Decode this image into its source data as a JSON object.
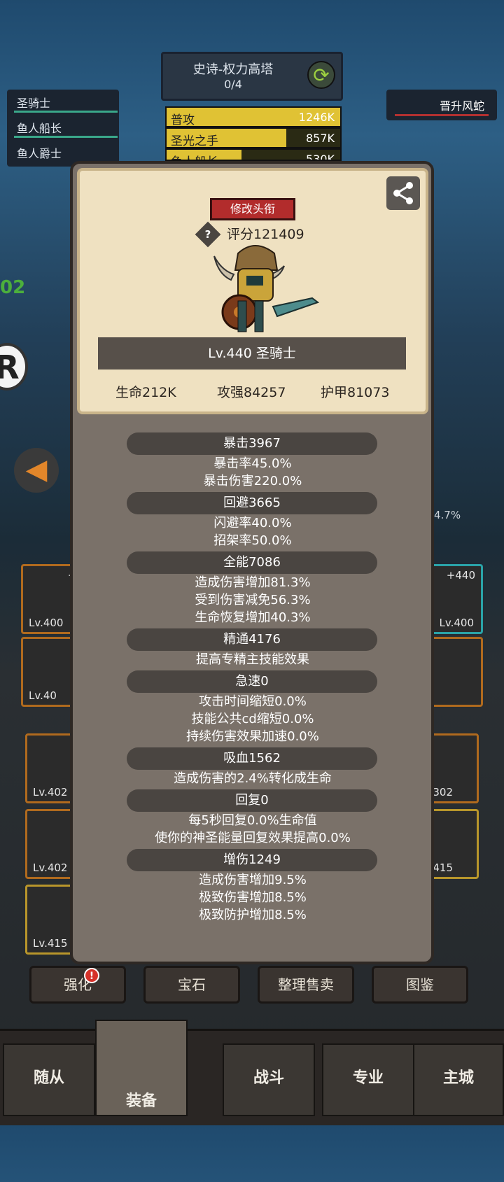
{
  "tower": {
    "title": "史诗-权力高塔",
    "progress": "0/4"
  },
  "left_list": [
    "圣骑士",
    "鱼人船长",
    "鱼人爵士"
  ],
  "right_tag": "晋升风蛇",
  "damage_rows": [
    {
      "name": "普攻",
      "value": "1246K",
      "fill": 1.0
    },
    {
      "name": "圣光之手",
      "value": "857K",
      "fill": 0.69
    },
    {
      "name": "鱼人船长",
      "value": "530K",
      "fill": 0.43
    }
  ],
  "bg_misc": {
    "big_letter": "R",
    "green_number": "02",
    "pct": "4.7%"
  },
  "slots": {
    "top_left_plus": "+4",
    "top_left_lvl": "Lv.400",
    "mid_left_lvl": "Lv.40",
    "top_right_plus": "+440",
    "top_right_lvl": "Lv.400",
    "lower_left_1": "Lv.402",
    "lower_left_2": "Lv.402",
    "lower_left_3": "Lv.415",
    "lower_right_1": "302",
    "lower_right_2": "415"
  },
  "modal": {
    "change_title_label": "修改头衔",
    "score_label": "评分121409",
    "hero_name": "Lv.440 圣骑士",
    "base_stats": {
      "hp": "生命212K",
      "attack": "攻强84257",
      "armor": "护甲81073"
    },
    "sections": [
      {
        "head": "暴击3967",
        "lines": [
          "暴击率45.0%",
          "暴击伤害220.0%"
        ]
      },
      {
        "head": "回避3665",
        "lines": [
          "闪避率40.0%",
          "招架率50.0%"
        ]
      },
      {
        "head": "全能7086",
        "lines": [
          "造成伤害增加81.3%",
          "受到伤害减免56.3%",
          "生命恢复增加40.3%"
        ]
      },
      {
        "head": "精通4176",
        "lines": [
          "提高专精主技能效果"
        ]
      },
      {
        "head": "急速0",
        "lines": [
          "攻击时间缩短0.0%",
          "技能公共cd缩短0.0%",
          "持续伤害效果加速0.0%"
        ]
      },
      {
        "head": "吸血1562",
        "lines": [
          "造成伤害的2.4%转化成生命"
        ]
      },
      {
        "head": "回复0",
        "lines": [
          "每5秒回复0.0%生命值",
          "使你的神圣能量回复效果提高0.0%"
        ]
      },
      {
        "head": "增伤1249",
        "lines": [
          "造成伤害增加9.5%",
          "极致伤害增加8.5%",
          "极致防护增加8.5%"
        ]
      }
    ]
  },
  "actions": [
    "强化",
    "宝石",
    "整理售卖",
    "图鉴"
  ],
  "badge": "!",
  "nav": [
    "随从",
    "装备",
    "战斗",
    "专业",
    "主城"
  ],
  "colors": {
    "panel": "#7a7169",
    "card": "#efe1c1",
    "section_pill": "#4a4541",
    "title_button": "#b22c2c"
  }
}
